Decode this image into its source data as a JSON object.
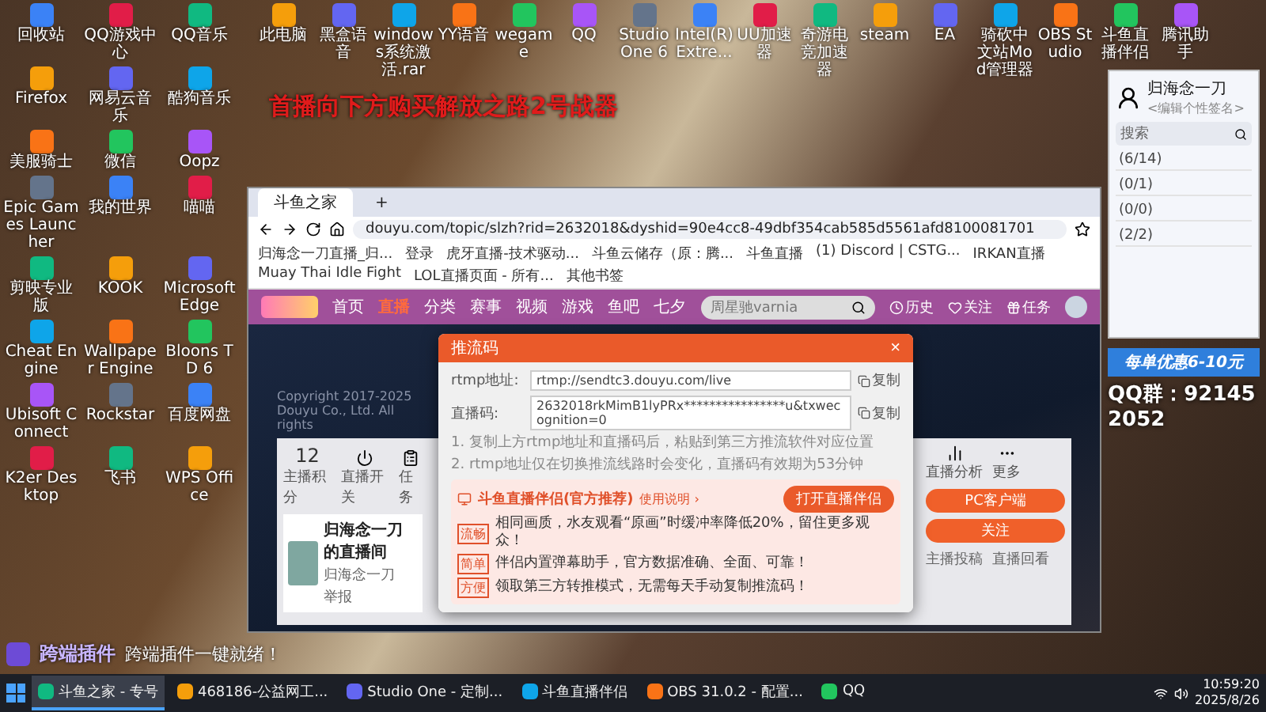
{
  "banner": "首播向下方购买解放之路2号战器",
  "desktop_top": [
    "此电脑",
    "黑盒语音",
    "windows系统激活.rar",
    "YY语音",
    "wegame",
    "QQ",
    "Studio One 6",
    "Intel(R) Extre...",
    "UU加速器",
    "奇游电竞加速器",
    "steam",
    "EA",
    "骑砍中文站Mod管理器",
    "OBS Studio",
    "斗鱼直播伴侣",
    "腾讯助手"
  ],
  "desktop_left": [
    "回收站",
    "QQ游戏中心",
    "QQ音乐",
    "Firefox",
    "网易云音乐",
    "酷狗音乐",
    "美服骑士",
    "微信",
    "Oopz",
    "Epic Games Launcher",
    "我的世界",
    "喵喵",
    "剪映专业版",
    "KOOK",
    "Microsoft Edge",
    "Cheat Engine",
    "Wallpaper Engine",
    "Bloons TD 6",
    "Ubisoft Connect",
    "Rockstar",
    "百度网盘",
    "K2er Desktop",
    "飞书",
    "WPS Office"
  ],
  "browser": {
    "tabs": [
      {
        "label": "斗鱼之家",
        "selected": true
      },
      {
        "label": "+",
        "selected": false
      }
    ],
    "url": "douyu.com/topic/slzh?rid=2632018&dyshid=90e4cc8-49dbf354cab585d5561afd8100081701",
    "bookmarks": [
      "归海念一刀直播_归...",
      "登录",
      "虎牙直播-技术驱动...",
      "斗鱼云储存（原：腾...",
      "斗鱼直播",
      "(1) Discord | CSTG...",
      "IRKAN直播",
      "Muay Thai Idle Fight",
      "LOL直播页面 - 所有...",
      "其他书签"
    ],
    "nav": [
      {
        "label": "首页",
        "selected": false
      },
      {
        "label": "直播",
        "selected": true
      },
      {
        "label": "分类",
        "selected": false
      },
      {
        "label": "赛事",
        "selected": false
      },
      {
        "label": "视频",
        "selected": false
      },
      {
        "label": "游戏",
        "selected": false
      },
      {
        "label": "鱼吧",
        "selected": false
      },
      {
        "label": "七夕",
        "selected": false
      }
    ],
    "search_placeholder": "周星驰varnia",
    "header_actions": [
      "历史",
      "关注",
      "任务"
    ],
    "copyright": "Copyright 2017-2025 Douyu Co., Ltd. All rights",
    "studio": {
      "score": "12",
      "score_label": "主播积分",
      "tools_left": [
        "直播开关",
        "任务"
      ],
      "tools_right": [
        "直播分析",
        "更多"
      ],
      "client_button": "PC客户端",
      "room_name": "归海念一刀的直播间",
      "host": "归海念一刀",
      "report": "举报",
      "follow": "关注",
      "right_tabs": [
        "主播投稿",
        "直播回看"
      ]
    }
  },
  "dialog": {
    "title": "推流码",
    "close": "×",
    "fields": [
      {
        "label": "rtmp地址:",
        "value": "rtmp://sendtc3.douyu.com/live",
        "copy": "复制"
      },
      {
        "label": "直播码:",
        "value": "2632018rkMimB1lyPRx****************u&txwecognition=0",
        "copy": "复制"
      }
    ],
    "notes": [
      "1. 复制上方rtmp地址和直播码后，粘贴到第三方推流软件对应位置",
      "2. rtmp地址仅在切换推流线路时会变化，直播码有效期为53分钟"
    ],
    "promo": {
      "title": "斗鱼直播伴侣(官方推荐)",
      "help": "使用说明 ›",
      "button": "打开直播伴侣",
      "points": [
        {
          "tag": "流畅",
          "text": "相同画质，水友观看“原画”时缓冲率降低20%，留住更多观众！"
        },
        {
          "tag": "简单",
          "text": "伴侣内置弹幕助手，官方数据准确、全面、可靠！"
        },
        {
          "tag": "方便",
          "text": "领取第三方转推模式，无需每天手动复制推流码！"
        }
      ]
    }
  },
  "qq": {
    "name": "归海念一刀",
    "signature": "<编辑个性签名>",
    "search_placeholder": "搜索",
    "groups": [
      "(6/14)",
      "(0/1)",
      "(0/0)",
      "(2/2)"
    ]
  },
  "promo": {
    "discount": "每单优惠6-10元",
    "qq_group": "QQ群：921452052"
  },
  "notice": {
    "title": "跨端插件",
    "message": "跨端插件一键就绪！"
  },
  "taskbar": {
    "apps": [
      {
        "label": "斗鱼之家 - 专号",
        "selected": true
      },
      {
        "label": "468186-公益网工...",
        "selected": false
      },
      {
        "label": "Studio One - 定制...",
        "selected": false
      },
      {
        "label": "斗鱼直播伴侣",
        "selected": false
      },
      {
        "label": "OBS 31.0.2 - 配置...",
        "selected": false
      },
      {
        "label": "QQ",
        "selected": false
      }
    ],
    "time": "10:59:20",
    "date": "2025/8/26"
  }
}
